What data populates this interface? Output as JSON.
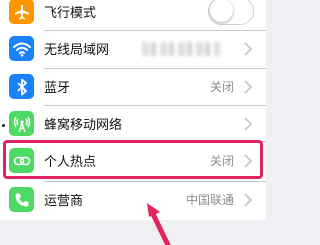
{
  "settings": {
    "rows": [
      {
        "label": "飞行模式",
        "icon": "airplane-icon",
        "color": "#ff9500"
      },
      {
        "label": "无线局域网",
        "icon": "wifi-icon",
        "color": "#1a82fb"
      },
      {
        "label": "蓝牙",
        "icon": "bluetooth-icon",
        "color": "#1a82fb",
        "value": "关闭"
      },
      {
        "label": "蜂窝移动网络",
        "icon": "cellular-icon",
        "color": "#4cd964"
      },
      {
        "label": "个人热点",
        "icon": "hotspot-icon",
        "color": "#4cd964",
        "value": "关闭"
      },
      {
        "label": "运营商",
        "icon": "phone-icon",
        "color": "#4cd964",
        "value": "中国联通"
      }
    ]
  },
  "highlight_color": "#e0245e"
}
